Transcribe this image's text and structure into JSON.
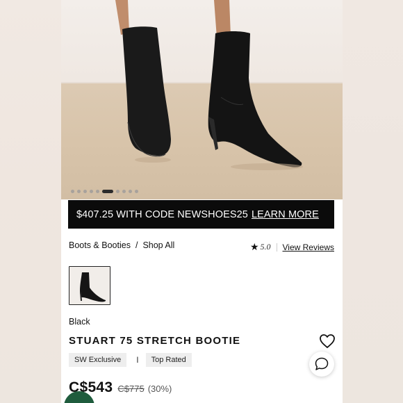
{
  "hero": {
    "carousel_total": 10,
    "carousel_active": 6
  },
  "promo": {
    "text": "$407.25 WITH CODE NEWSHOES25",
    "link": "LEARN MORE"
  },
  "breadcrumb": {
    "items": [
      "Boots & Booties",
      "/",
      "Shop All"
    ]
  },
  "rating": {
    "star": "★",
    "score": "5.0",
    "reviews_link": "View Reviews"
  },
  "product": {
    "color": "Black",
    "title": "STUART 75 STRETCH BOOTIE",
    "badges": [
      "SW Exclusive",
      "Top Rated"
    ],
    "badge_separator": "I",
    "price": "C$543",
    "original_price": "C$775",
    "discount": "(30%)"
  },
  "icons": [
    "heart-icon",
    "chat-icon",
    "star-icon"
  ]
}
